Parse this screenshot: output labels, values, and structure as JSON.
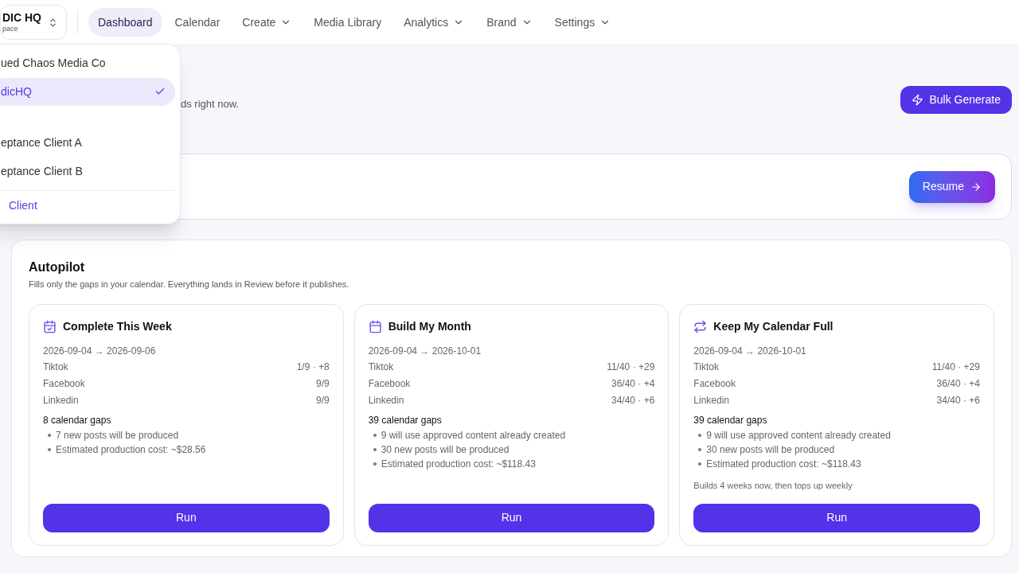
{
  "workspace": {
    "name": "DIC HQ",
    "subtitle": "pace"
  },
  "nav": [
    {
      "label": "Dashboard",
      "selected": true,
      "dropdown": false
    },
    {
      "label": "Calendar",
      "selected": false,
      "dropdown": false
    },
    {
      "label": "Create",
      "selected": false,
      "dropdown": true
    },
    {
      "label": "Media Library",
      "selected": false,
      "dropdown": false
    },
    {
      "label": "Analytics",
      "selected": false,
      "dropdown": true
    },
    {
      "label": "Brand",
      "selected": false,
      "dropdown": true
    },
    {
      "label": "Settings",
      "selected": false,
      "dropdown": true
    }
  ],
  "workspace_menu": {
    "items": [
      {
        "label": "ued Chaos Media Co",
        "selected": false
      },
      {
        "label": "dicHQ",
        "selected": true
      },
      {
        "label": "eptance Client A",
        "selected": false
      },
      {
        "label": "eptance Client B",
        "selected": false
      }
    ],
    "add_action": "Client"
  },
  "header": {
    "subtitle": "ds right now.",
    "bulk_button": "Bulk Generate"
  },
  "resume": {
    "button": "Resume"
  },
  "autopilot": {
    "title": "Autopilot",
    "description": "Fills only the gaps in your calendar. Everything lands in Review before it publishes.",
    "cards": [
      {
        "title": "Complete This Week",
        "range": "2026-09-04 → 2026-09-06",
        "platforms": [
          {
            "name": "Tiktok",
            "value": "1/9 · +8"
          },
          {
            "name": "Facebook",
            "value": "9/9"
          },
          {
            "name": "Linkedin",
            "value": "9/9"
          }
        ],
        "gaps": "8 calendar gaps",
        "bullets": [
          "7 new posts will be produced",
          "Estimated production cost: ~$28.56"
        ],
        "button": "Run"
      },
      {
        "title": "Build My Month",
        "range": "2026-09-04 → 2026-10-01",
        "platforms": [
          {
            "name": "Tiktok",
            "value": "11/40 · +29"
          },
          {
            "name": "Facebook",
            "value": "36/40 · +4"
          },
          {
            "name": "Linkedin",
            "value": "34/40 · +6"
          }
        ],
        "gaps": "39 calendar gaps",
        "bullets": [
          "9 will use approved content already created",
          "30 new posts will be produced",
          "Estimated production cost: ~$118.43"
        ],
        "button": "Run"
      },
      {
        "title": "Keep My Calendar Full",
        "range": "2026-09-04 → 2026-10-01",
        "platforms": [
          {
            "name": "Tiktok",
            "value": "11/40 · +29"
          },
          {
            "name": "Facebook",
            "value": "36/40 · +4"
          },
          {
            "name": "Linkedin",
            "value": "34/40 · +6"
          }
        ],
        "gaps": "39 calendar gaps",
        "bullets": [
          "9 will use approved content already created",
          "30 new posts will be produced",
          "Estimated production cost: ~$118.43"
        ],
        "note": "Builds 4 weeks now, then tops up weekly",
        "button": "Run"
      }
    ]
  }
}
